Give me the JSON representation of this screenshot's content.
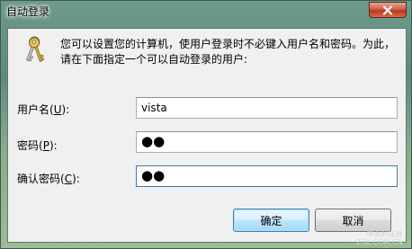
{
  "window": {
    "title": "自动登录"
  },
  "prompt": {
    "line1": "您可以设置您的计算机，使用户登录时不必键入用户名和密码。为此，",
    "line2": "请在下面指定一个可以自动登录的用户:"
  },
  "fields": {
    "username": {
      "label_before": "用户名(",
      "mnemonic": "U",
      "label_after": "):",
      "value": "vista"
    },
    "password": {
      "label_before": "密码(",
      "mnemonic": "P",
      "label_after": "):",
      "value": "●●"
    },
    "confirm": {
      "label_before": "确认密码(",
      "mnemonic": "C",
      "label_after": "):",
      "value": "●●"
    }
  },
  "buttons": {
    "ok": "确定",
    "cancel": "取消"
  },
  "watermark": {
    "line1": "中关村在线",
    "line2": "ZOL.COM.CN"
  },
  "colors": {
    "client_background": "#f0f0f0",
    "default_button_border": "#3c7fb1",
    "close_button": "#c8482a"
  },
  "icons": {
    "window_close": "close-icon",
    "header": "keys-icon"
  }
}
